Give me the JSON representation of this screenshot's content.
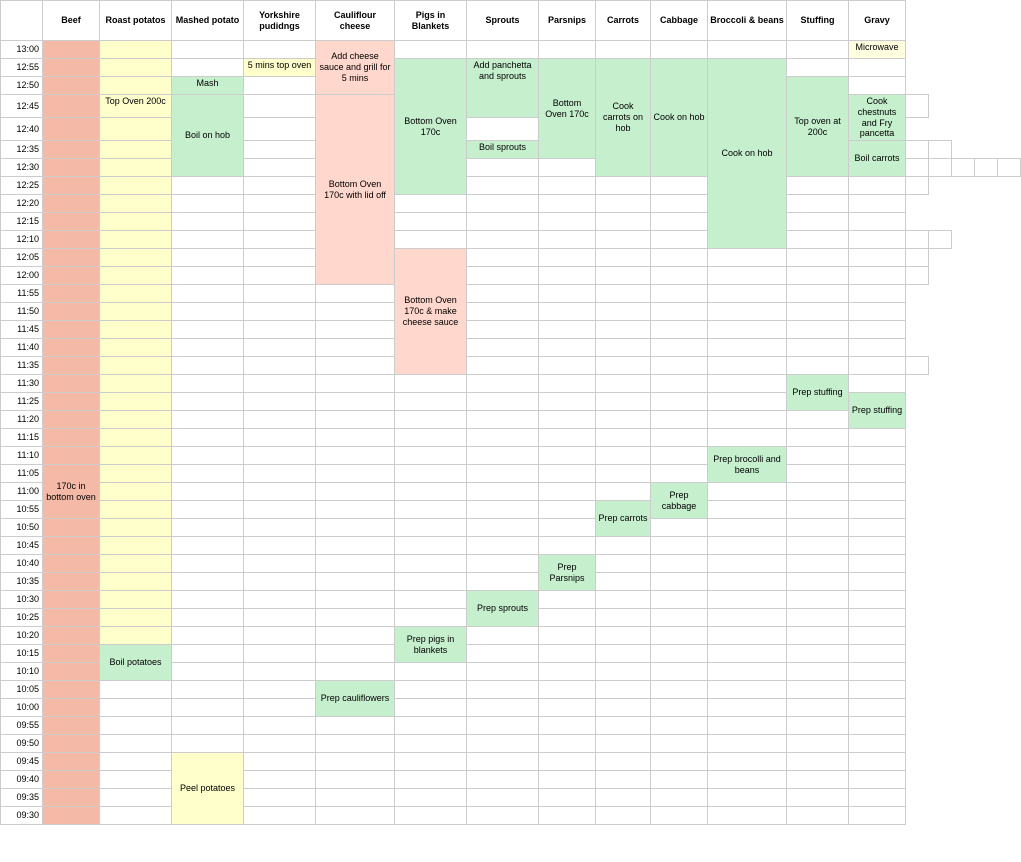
{
  "columns": [
    {
      "key": "time",
      "label": "",
      "class": "col-time"
    },
    {
      "key": "beef",
      "label": "Beef",
      "class": "col-beef"
    },
    {
      "key": "roast",
      "label": "Roast potatos",
      "class": "col-roast"
    },
    {
      "key": "mashed",
      "label": "Mashed potato",
      "class": "col-mashed"
    },
    {
      "key": "yorkshire",
      "label": "Yorkshire pudidngs",
      "class": "col-yorkshire"
    },
    {
      "key": "cauliflower",
      "label": "Cauliflour cheese",
      "class": "col-cauliflower"
    },
    {
      "key": "pigs",
      "label": "Pigs in Blankets",
      "class": "col-pigs"
    },
    {
      "key": "sprouts",
      "label": "Sprouts",
      "class": "col-sprouts"
    },
    {
      "key": "parsnips",
      "label": "Parsnips",
      "class": "col-parsnips"
    },
    {
      "key": "carrots",
      "label": "Carrots",
      "class": "col-carrots"
    },
    {
      "key": "cabbage",
      "label": "Cabbage",
      "class": "col-cabbage"
    },
    {
      "key": "broccoli",
      "label": "Broccoli & beans",
      "class": "col-broccoli"
    },
    {
      "key": "stuffing",
      "label": "Stuffing",
      "class": "col-stuffing"
    },
    {
      "key": "gravy",
      "label": "Gravy",
      "class": "col-gravy"
    }
  ],
  "times": [
    "13:00",
    "12:55",
    "12:50",
    "12:45",
    "12:40",
    "12:35",
    "12:30",
    "12:25",
    "12:20",
    "12:15",
    "12:10",
    "12:05",
    "12:00",
    "11:55",
    "11:50",
    "11:45",
    "11:40",
    "11:35",
    "11:30",
    "11:25",
    "11:20",
    "11:15",
    "11:10",
    "11:05",
    "11:00",
    "10:55",
    "10:50",
    "10:45",
    "10:40",
    "10:35",
    "10:30",
    "10:25",
    "10:20",
    "10:15",
    "10:10",
    "10:05",
    "10:00",
    "09:55",
    "09:50",
    "09:45",
    "09:40",
    "09:35",
    "09:30"
  ]
}
